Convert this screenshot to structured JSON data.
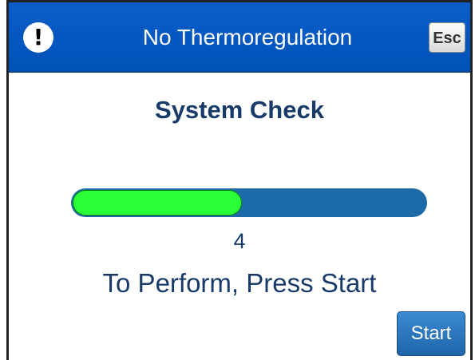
{
  "header": {
    "title": "No Thermoregulation",
    "alert_icon": "!",
    "esc_label": "Esc",
    "background_color": "#0055bb"
  },
  "main": {
    "heading": "System Check",
    "progress": {
      "fraction": 0.48,
      "value_text": "4",
      "fill_color": "#2bff3a",
      "track_color": "#1d6aa8"
    },
    "instruction": "To Perform, Press Start",
    "start_label": "Start"
  }
}
